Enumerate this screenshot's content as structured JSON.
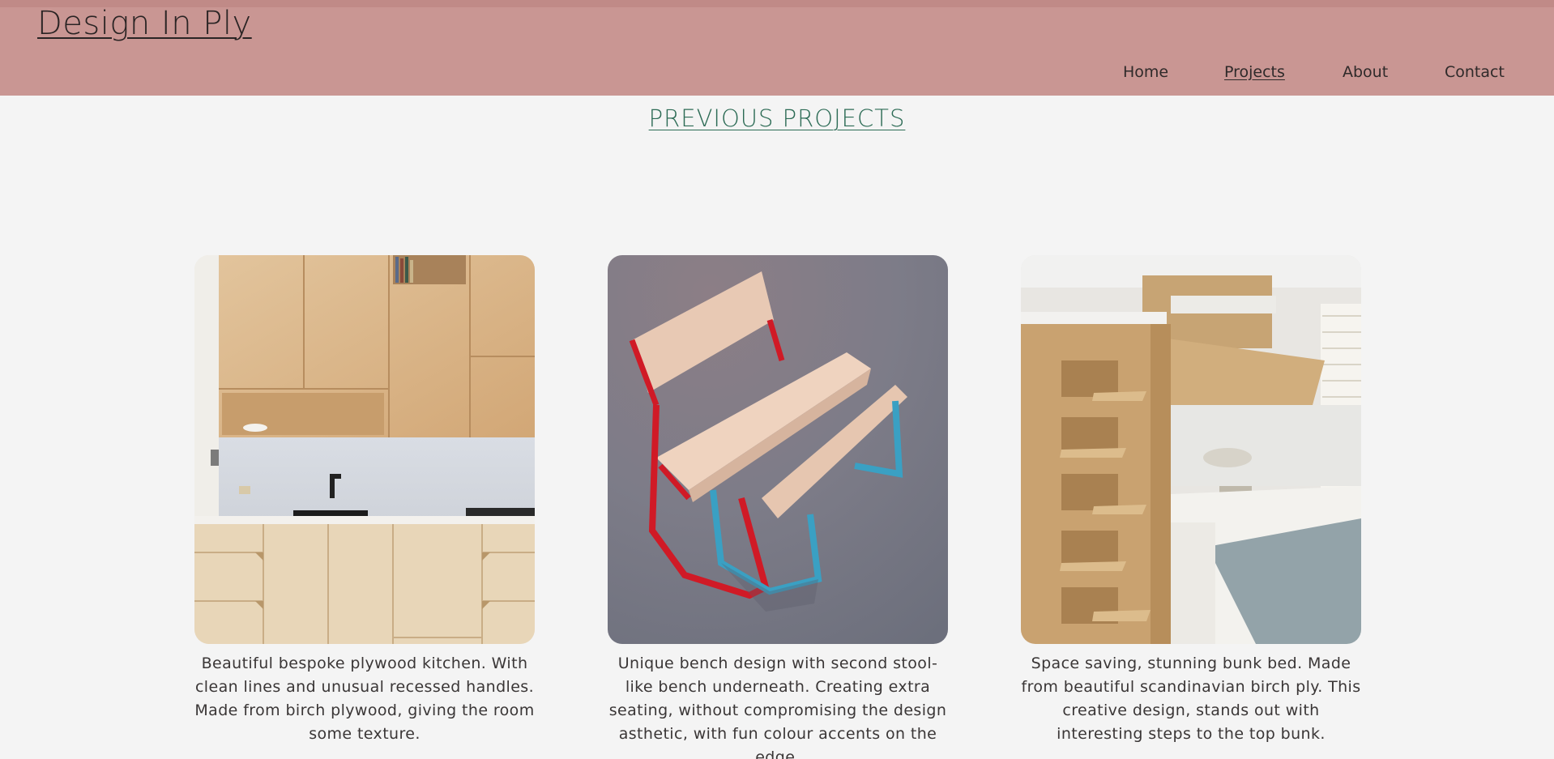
{
  "site": {
    "logo": "Design In Ply"
  },
  "nav": [
    {
      "label": "Home",
      "active": false
    },
    {
      "label": "Projects",
      "active": true
    },
    {
      "label": "About",
      "active": false
    },
    {
      "label": "Contact",
      "active": false
    }
  ],
  "page": {
    "title": "PREVIOUS PROJECTS"
  },
  "projects": [
    {
      "image": "plywood-kitchen-photo",
      "caption": "Beautiful bespoke plywood kitchen. With clean lines and unusual recessed handles. Made from birch plywood, giving the room some texture."
    },
    {
      "image": "plywood-bench-photo",
      "caption": "Unique bench design with second stool-like bench underneath. Creating extra seating, without compromising the design asthetic, with fun colour accents on the edge."
    },
    {
      "image": "plywood-bunk-bed-photo",
      "caption": "Space saving, stunning bunk bed. Made from beautiful scandinavian birch ply. This creative design, stands out with interesting steps to the top bunk."
    }
  ],
  "colors": {
    "header": "#c99693",
    "title": "#2c6b55",
    "background": "#f4f4f4"
  }
}
